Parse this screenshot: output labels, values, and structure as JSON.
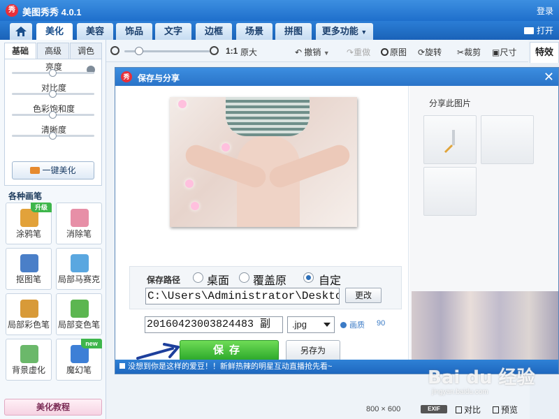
{
  "app": {
    "title": "美图秀秀 4.0.1",
    "logo_text": "秀",
    "login": "登录",
    "open": "打开"
  },
  "tabs": [
    "美化",
    "美容",
    "饰品",
    "文字",
    "边框",
    "场景",
    "拼图",
    "更多功能"
  ],
  "left_panel": {
    "subtabs": [
      "基础",
      "高级",
      "调色"
    ],
    "sliders": [
      {
        "label": "亮度",
        "value": 0.5
      },
      {
        "label": "对比度",
        "value": 0.5
      },
      {
        "label": "色彩饱和度",
        "value": 0.5
      },
      {
        "label": "清晰度",
        "value": 0.5
      }
    ],
    "one_key": "一键美化",
    "tools_title": "各种画笔",
    "tools": [
      {
        "label": "涂鸦笔",
        "badge": "升级",
        "color": "#e2a23a"
      },
      {
        "label": "消除笔",
        "badge": "",
        "color": "#e78fa7"
      },
      {
        "label": "抠图笔",
        "badge": "",
        "color": "#4a7fc8"
      },
      {
        "label": "局部马赛克",
        "badge": "",
        "color": "#5aa7e0"
      },
      {
        "label": "局部彩色笔",
        "badge": "",
        "color": "#d89a38"
      },
      {
        "label": "局部变色笔",
        "badge": "",
        "color": "#5cb650"
      },
      {
        "label": "背景虚化",
        "badge": "",
        "color": "#6bb86a"
      },
      {
        "label": "魔幻笔",
        "badge": "new",
        "color": "#3d7fd6"
      }
    ],
    "tutorial": "美化教程"
  },
  "toolbar": {
    "ratio": "1:1",
    "original_size": "原大",
    "zoom_level": 0.17,
    "undo": "撤销",
    "redo": "重做",
    "original": "原图",
    "rotate": "旋转",
    "crop": "裁剪",
    "resize": "尺寸",
    "effects_tab": "特效"
  },
  "dialog": {
    "title": "保存与分享",
    "logo_text": "秀",
    "close": "✕",
    "save_path_label": "保存路径",
    "path_options": [
      {
        "label": "桌面",
        "checked": false
      },
      {
        "label": "覆盖原",
        "checked": false
      },
      {
        "label": "自定",
        "checked": true
      }
    ],
    "path_value": "C:\\Users\\Administrator\\Deskto",
    "change_button": "更改",
    "filename": "20160423003824483 副",
    "extension": ".jpg",
    "quality_label": "画质",
    "quality_value": "90",
    "save_button": "保存",
    "save_as_button": "另存为",
    "share_label": "分享此图片",
    "news": "没想到你是这样的爱豆！！新鲜热辣的明星互动直播抢先看~"
  },
  "status": {
    "dimensions": "800 × 600",
    "exif": "EXIF",
    "compare": "对比",
    "preview": "预览"
  },
  "watermark": {
    "brand": "Bai du 经验",
    "url": "jingyan.baidu.com"
  },
  "colors": {
    "accent": "#2a74c8",
    "save_green": "#2ba82a",
    "arrow_blue": "#1d3f9c"
  }
}
